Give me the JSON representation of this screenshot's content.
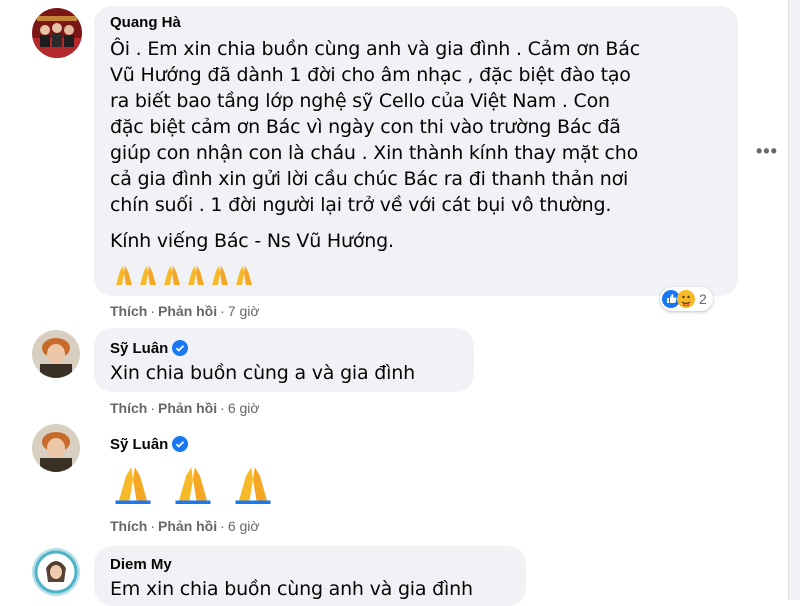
{
  "comments": [
    {
      "name": "Quang Hà",
      "lines": [
        "Ôi . Em xin chia buồn cùng anh và gia đình . Cảm ơn Bác",
        "Vũ Hướng đã dành 1 đời cho âm nhạc , đặc biệt đào tạo",
        "ra biết bao tầng lớp nghệ sỹ Cello của Việt Nam . Con",
        "đặc biệt cảm ơn Bác vì ngày con thi vào trường Bác đã",
        "giúp con nhận con là cháu . Xin thành kính thay mặt cho",
        "cả gia đình xin gửi lời cầu chúc Bác ra đi thanh thản nơi",
        "chín suối . 1 đời người lại trở về với cát bụi vô thường."
      ],
      "signoff": "Kính viếng Bác - Ns Vũ Hướng.",
      "like": "Thích",
      "reply": "Phản hồi",
      "time": "7 giờ",
      "reaction_count": "2"
    },
    {
      "name": "Sỹ Luân",
      "text": "Xin chia buồn cùng a và gia đình",
      "like": "Thích",
      "reply": "Phản hồi",
      "time": "6 giờ"
    },
    {
      "name": "Sỹ Luân",
      "like": "Thích",
      "reply": "Phản hồi",
      "time": "6 giờ"
    },
    {
      "name": "Diem My",
      "text": "Em xin chia buồn cùng anh và gia đình"
    }
  ],
  "separator": "·",
  "more_glyph": "•••",
  "colors": {
    "bubble": "#f0f2f5",
    "secondary_text": "#65676b",
    "verified": "#1877f2",
    "pray": "#f7b928"
  }
}
